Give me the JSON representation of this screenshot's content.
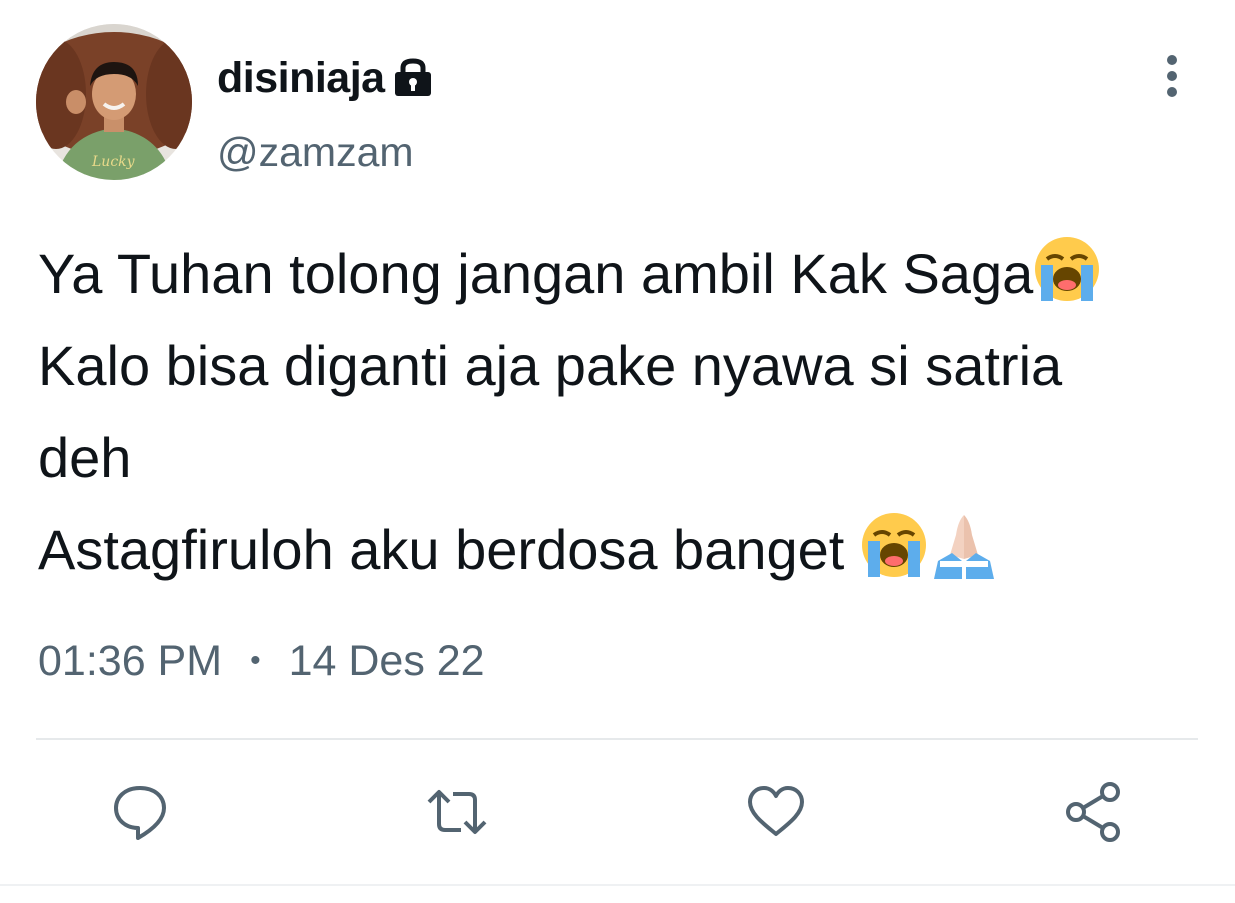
{
  "tweet": {
    "author": {
      "display_name": "disiniaja",
      "handle": "@zamzam",
      "protected_icon": "lock-icon",
      "avatar_shirt_text": "Lucky"
    },
    "text_lines": [
      "Ya Tuhan tolong jangan ambil Kak Saga",
      "Kalo bisa diganti aja pake nyawa si satria",
      "deh",
      "Astagfiruloh aku berdosa banget"
    ],
    "emojis": [
      "loudly-crying-face-emoji",
      "loudly-crying-face-emoji",
      "folded-hands-emoji"
    ],
    "time": "01:36 PM",
    "separator": "•",
    "date": "14 Des 22",
    "actions": [
      "reply-icon",
      "retweet-icon",
      "like-icon",
      "share-icon"
    ],
    "more_icon": "more-vertical-icon"
  },
  "colors": {
    "text_primary": "#0f1419",
    "text_secondary": "#536471",
    "divider": "#e6e9eb",
    "icon_gray": "#536471"
  }
}
